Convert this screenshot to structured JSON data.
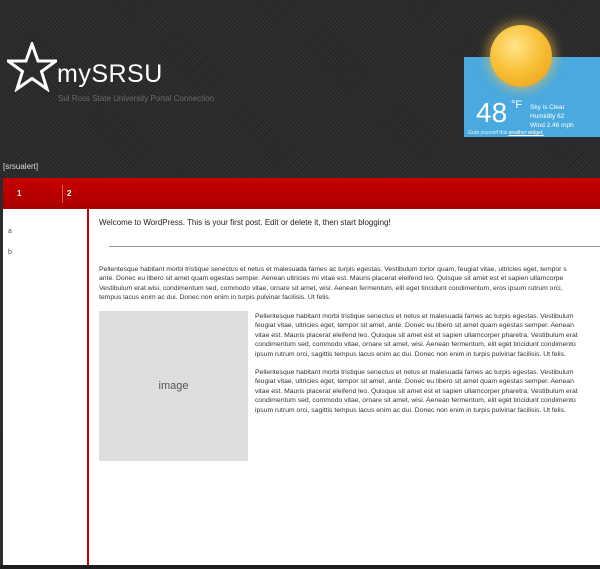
{
  "site": {
    "title": "mySRSU",
    "tagline": "Sul Ross State University Portal Connection"
  },
  "weather": {
    "temperature": "48",
    "unit": "°F",
    "condition": "Sky is Clear",
    "humidity": "Humidity 62",
    "wind": "Wind 2.46 mph",
    "footer_text": "Grab yourself this",
    "footer_link": "weather widget.",
    "icon": "sun-icon"
  },
  "alert": "[srsualert]",
  "nav": {
    "items": [
      {
        "label": "1"
      },
      {
        "label": "2"
      }
    ]
  },
  "sidebar": {
    "items": [
      {
        "label": "a"
      },
      {
        "label": "b"
      }
    ]
  },
  "post": {
    "welcome": "Welcome to WordPress. This is your first post. Edit or delete it, then start blogging!",
    "image_placeholder": "image",
    "para1": [
      "Pellentesque habitant morbi tristique senectus et netus et malesuada fames ac turpis egestas. Vestibulum tortor quam, feugiat vitae, ultricies eget, tempor s",
      "ante. Donec eu libero sit amet quam egestas semper. Aenean ultricies mi vitae est. Mauris placerat eleifend leo. Quisque sit amet est et sapien ullamcorpe",
      "Vestibulum erat wisi, condimentum sed, commodo vitae, ornare sit amet, wisi. Aenean fermentum, elit eget tincidunt condimentum, eros ipsum rutrum orci,",
      "tempus lacus enim ac dui. Donec non enim in turpis pulvinar facilisis. Ut felis."
    ],
    "para2": [
      "Pellentesque habitant morbi tristique senectus et netus et malesuada fames ac turpis egestas. Vestibulum",
      "feugiat vitae, ultricies eget, tempor sit amet, ante. Donec eu libero sit amet quam egestas semper. Aenean",
      "vitae est. Mauris placerat eleifend leo. Quisque sit amet est et sapien ullamcorper pharetra. Vestibulum erat",
      "condimentum sed, commodo vitae, ornare sit amet, wisi. Aenean fermentum, elit eget tincidunt condimentu",
      "ipsum rutrum orci, sagittis tempus lacus enim ac dui. Donec non enim in turpis pulvinar facilisis. Ut felis."
    ],
    "para3": [
      "Pellentesque habitant morbi tristique senectus et netus et malesuada fames ac turpis egestas. Vestibulum",
      "feugiat vitae, ultricies eget, tempor sit amet, ante. Donec eu libero sit amet quam egestas semper. Aenean",
      "vitae est. Mauris placerat eleifend leo. Quisque sit amet est et sapien ullamcorper pharetra. Vestibulum erat",
      "condimentum sed, commodo vitae, ornare sit amet, wisi. Aenean fermentum, elit eget tincidunt condimentu",
      "ipsum rutrum orci, sagittis tempus lacus enim ac dui. Donec non enim in turpis pulvinar facilisis. Ut felis."
    ]
  },
  "colors": {
    "nav_red": "#b80000",
    "divider_red": "#c40000",
    "weather_blue": "#4aa9de"
  }
}
